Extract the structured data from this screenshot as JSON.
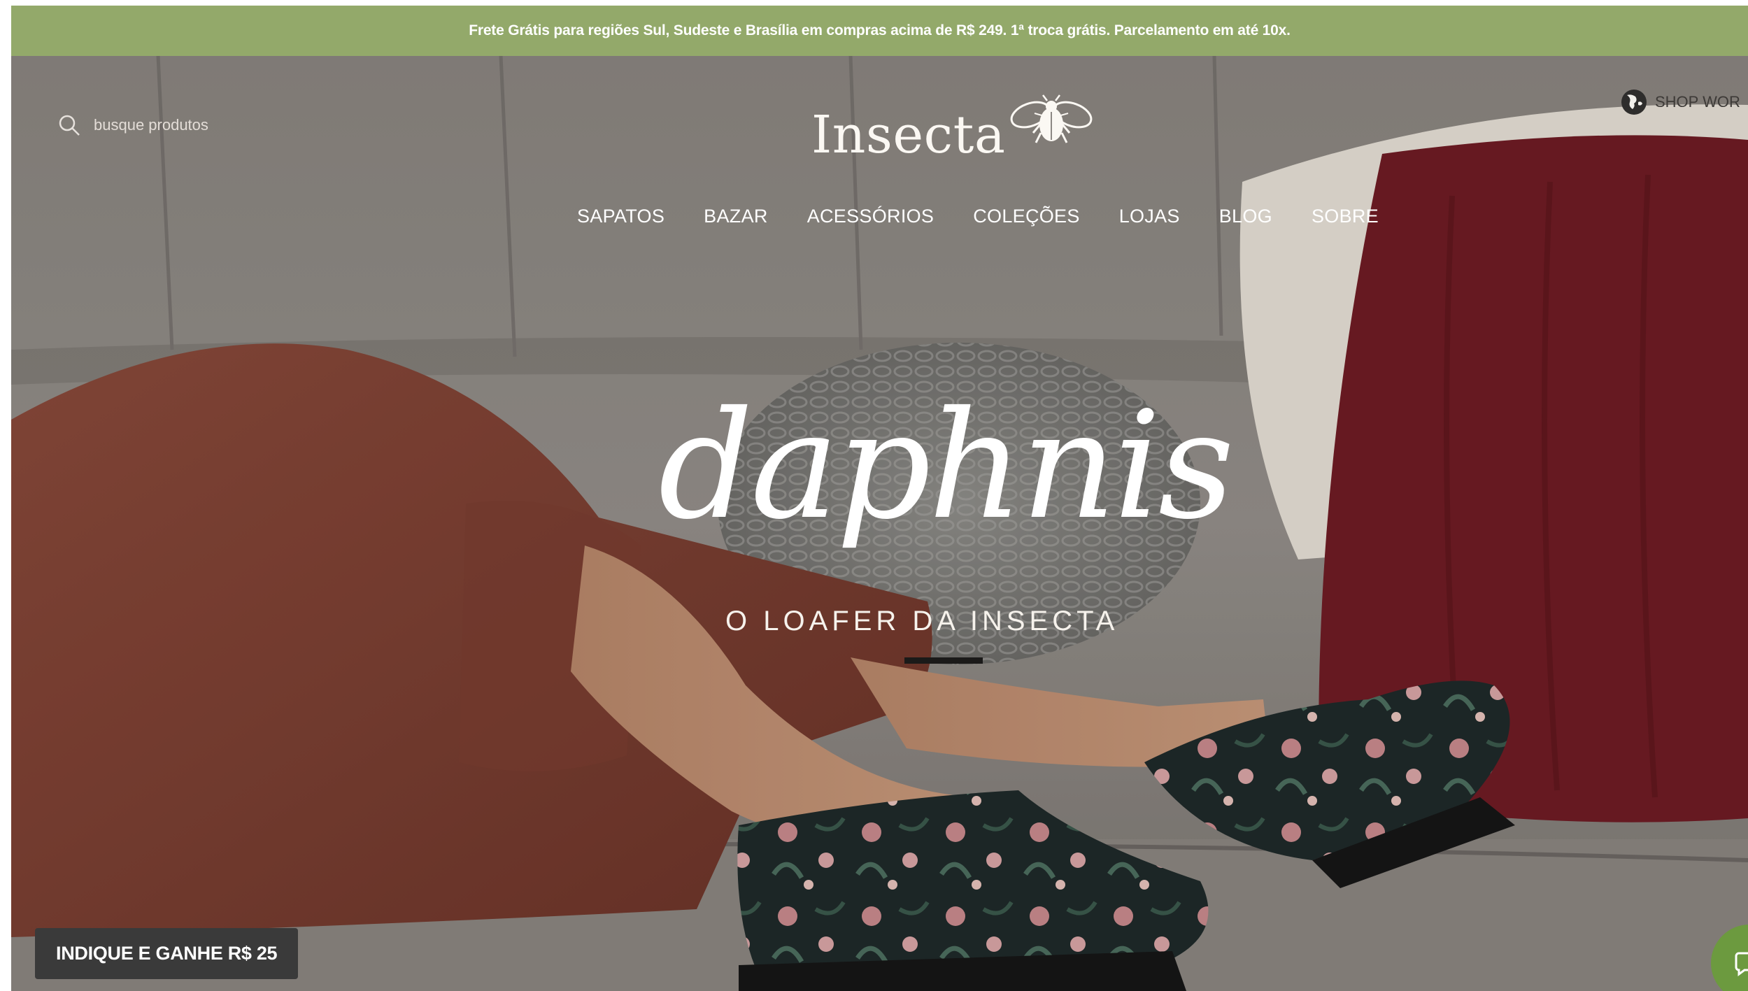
{
  "promo": {
    "text": "Frete Grátis para regiões Sul, Sudeste e Brasília em compras acima de R$ 249. 1ª troca grátis. Parcelamento em até 10x."
  },
  "header": {
    "search_placeholder": "busque produtos",
    "logo_text": "Insecta",
    "shop_world_label": "SHOP WOR"
  },
  "nav": {
    "items": [
      "SAPATOS",
      "BAZAR",
      "ACESSÓRIOS",
      "COLEÇÕES",
      "LOJAS",
      "BLOG",
      "SOBRE"
    ]
  },
  "hero": {
    "title": "daphnis",
    "subtitle": "O LOAFER DA INSECTA"
  },
  "referral": {
    "label": "INDIQUE E GANHE R$ 25"
  },
  "colors": {
    "promo_bar": "#93a96a",
    "referral_button": "#3a3a3a",
    "chat_button": "#6c9a3f"
  },
  "icons": {
    "search": "search-icon",
    "globe": "globe-icon",
    "logo_mark": "beetle-logo-icon",
    "chat": "chat-icon"
  }
}
